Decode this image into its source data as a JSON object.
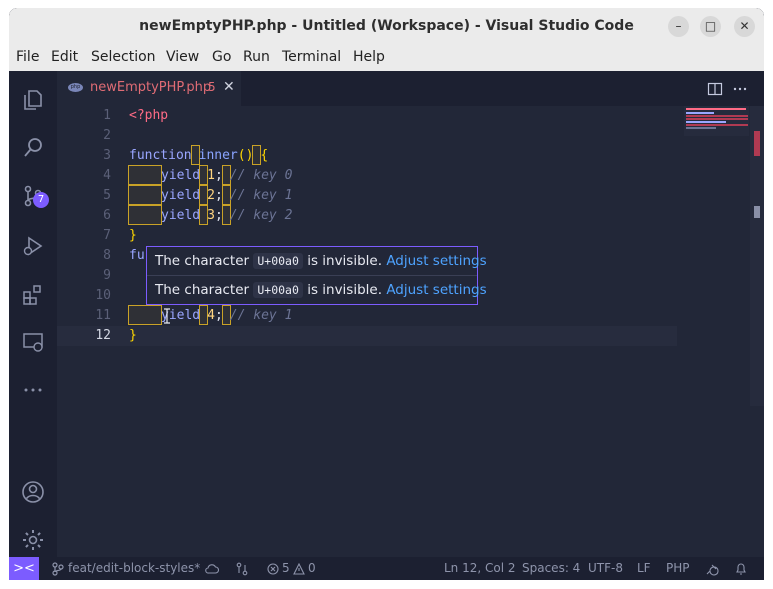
{
  "window": {
    "title": "newEmptyPHP.php - Untitled (Workspace) - Visual Studio Code",
    "buttons": {
      "minimize": "–",
      "maximize": "□",
      "close": "✕"
    }
  },
  "menu": [
    "File",
    "Edit",
    "Selection",
    "View",
    "Go",
    "Run",
    "Terminal",
    "Help"
  ],
  "activity_bar": {
    "icons": [
      "explorer-icon",
      "search-icon",
      "source-control-icon",
      "run-debug-icon",
      "extensions-icon",
      "remote-explorer-icon",
      "more-icon",
      "account-icon",
      "settings-gear-icon"
    ],
    "scm_badge": "7"
  },
  "tab": {
    "icon_label": "php",
    "name": "newEmptyPHP.php",
    "problems": "5",
    "close": "✕"
  },
  "editor": {
    "line_numbers": [
      "1",
      "2",
      "3",
      "4",
      "5",
      "6",
      "7",
      "8",
      "9",
      "10",
      "11",
      "12"
    ],
    "current_line": "12",
    "code": {
      "l1_open": "<?php",
      "kw_function": "function",
      "fn_inner": "inner",
      "parens": "()",
      "brace_open": "{",
      "brace_close": "}",
      "kw_yield": "yield",
      "n1": "1",
      "n2": "2",
      "n3": "3",
      "n4": "4",
      "semi": ";",
      "c0": "// key 0",
      "c1": "// key 1",
      "c2": "// key 2",
      "c_key1": "// key 1",
      "fu_partial": "fu"
    }
  },
  "hover": {
    "prefix": "The character",
    "code": "U+00a0",
    "suffix": "is invisible.",
    "link": "Adjust settings"
  },
  "statusbar": {
    "remote": "><",
    "branch": "feat/edit-block-styles*",
    "errors": "5",
    "warnings": "0",
    "position": "Ln 12, Col 2",
    "spaces": "Spaces: 4",
    "encoding": "UTF-8",
    "eol": "LF",
    "language": "PHP"
  }
}
